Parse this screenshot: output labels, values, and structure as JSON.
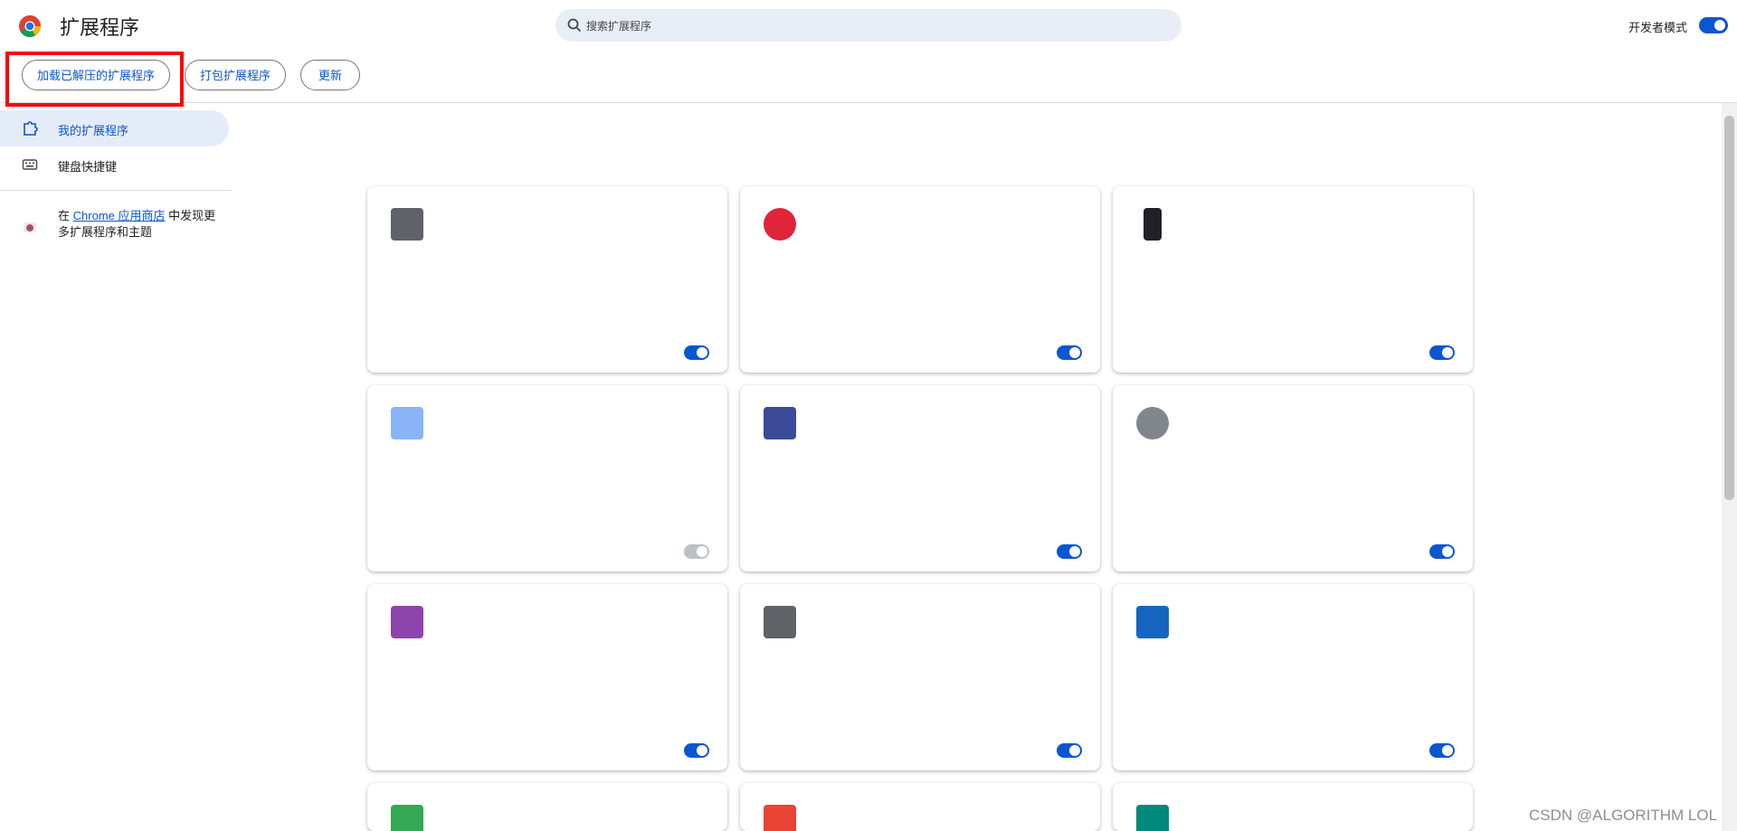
{
  "header": {
    "title": "扩展程序",
    "search_placeholder": "搜索扩展程序",
    "dev_mode_label": "开发者模式",
    "dev_mode_on": true,
    "accent": "#0b57d0"
  },
  "toolbar": {
    "load_unpacked": "加载已解压的扩展程序",
    "pack": "打包扩展程序",
    "update": "更新",
    "highlight_color": "#ff0000"
  },
  "sidebar": {
    "items": [
      {
        "label": "我的扩展程序",
        "icon": "puzzle-icon",
        "active": true
      },
      {
        "label": "键盘快捷键",
        "icon": "keyboard-icon",
        "active": false
      }
    ],
    "store_prefix": "在",
    "store_link": "Chrome 应用商店",
    "store_suffix": "中发现更多扩展程序和主题"
  },
  "watermark": "CSDN @ALGORITHM LOL"
}
